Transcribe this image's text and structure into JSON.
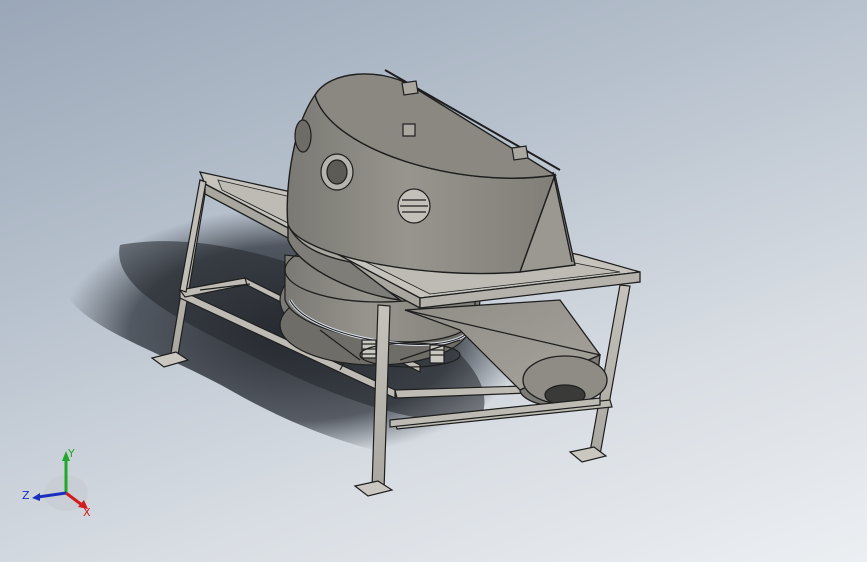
{
  "viewport": {
    "background_top": "#9aa7b8",
    "background_bottom": "#eceff2"
  },
  "model": {
    "body_color": "#8d8b84",
    "frame_color": "#b9b7b0",
    "edge_color": "#1e1e1e",
    "shadow_color": "#2b2f36"
  },
  "triad": {
    "x_label": "X",
    "y_label": "Y",
    "z_label": "Z",
    "x_color": "#d21c1c",
    "y_color": "#1fa82a",
    "z_color": "#1b2fbf"
  }
}
